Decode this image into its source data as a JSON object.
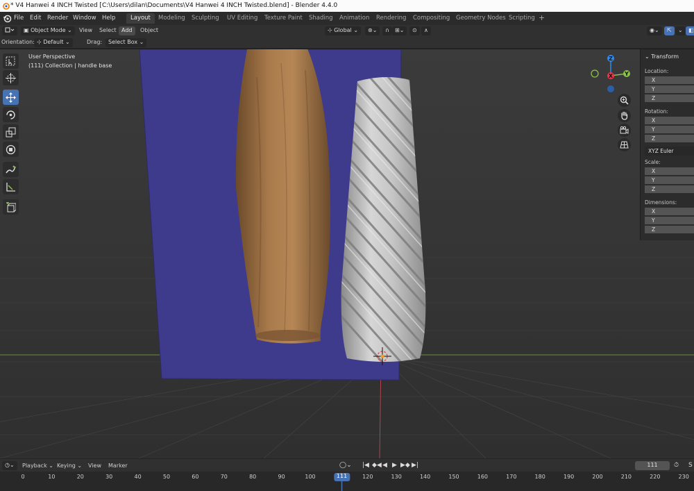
{
  "title_bar": {
    "text": "* V4 Hanwei 4 INCH Twisted [C:\\Users\\dilan\\Documents\\V4 Hanwei 4 INCH Twisted.blend] - Blender 4.4.0"
  },
  "top_menu": {
    "items": [
      "File",
      "Edit",
      "Render",
      "Window",
      "Help"
    ]
  },
  "workspaces": {
    "tabs": [
      "Layout",
      "Modeling",
      "Sculpting",
      "UV Editing",
      "Texture Paint",
      "Shading",
      "Animation",
      "Rendering",
      "Compositing",
      "Geometry Nodes",
      "Scripting"
    ],
    "active": "Layout",
    "add_label": "+"
  },
  "viewport_header": {
    "mode": "Object Mode",
    "menus": [
      "View",
      "Select",
      "Add",
      "Object"
    ],
    "transform_orientation": "Global"
  },
  "tool_header": {
    "orientation_label": "Orientation:",
    "orientation_value": "Default",
    "drag_label": "Drag:",
    "drag_value": "Select Box"
  },
  "viewport": {
    "perspective_label": "User Perspective",
    "collection_label": "(111) Collection | handle base"
  },
  "toolbar": {
    "tools": [
      "select-box-icon",
      "cursor-icon",
      "move-icon",
      "rotate-icon",
      "scale-icon",
      "transform-icon",
      "annotate-icon",
      "measure-icon",
      "add-cube-icon"
    ],
    "active": "move-icon"
  },
  "gizmo": {
    "x": "X",
    "y": "Y",
    "z": "Z",
    "colors": {
      "x": "#f0354b",
      "y": "#8bc34a",
      "z": "#2d8cf0"
    }
  },
  "n_panel": {
    "title": "Transform",
    "location_label": "Location:",
    "rotation_label": "Rotation:",
    "rotation_mode": "XYZ Euler",
    "scale_label": "Scale:",
    "dimensions_label": "Dimensions:",
    "axis": [
      "X",
      "Y",
      "Z"
    ]
  },
  "timeline_header": {
    "menus": [
      "Playback",
      "Keying",
      "View",
      "Marker"
    ],
    "current_frame": "111",
    "end_label": "S"
  },
  "timeline": {
    "ticks": [
      "0",
      "10",
      "20",
      "30",
      "40",
      "50",
      "60",
      "70",
      "80",
      "90",
      "100",
      "111",
      "120",
      "130",
      "140",
      "150",
      "160",
      "170",
      "180",
      "190",
      "200",
      "210",
      "220",
      "230"
    ],
    "current_frame": "111",
    "accent": "#4772b3"
  }
}
